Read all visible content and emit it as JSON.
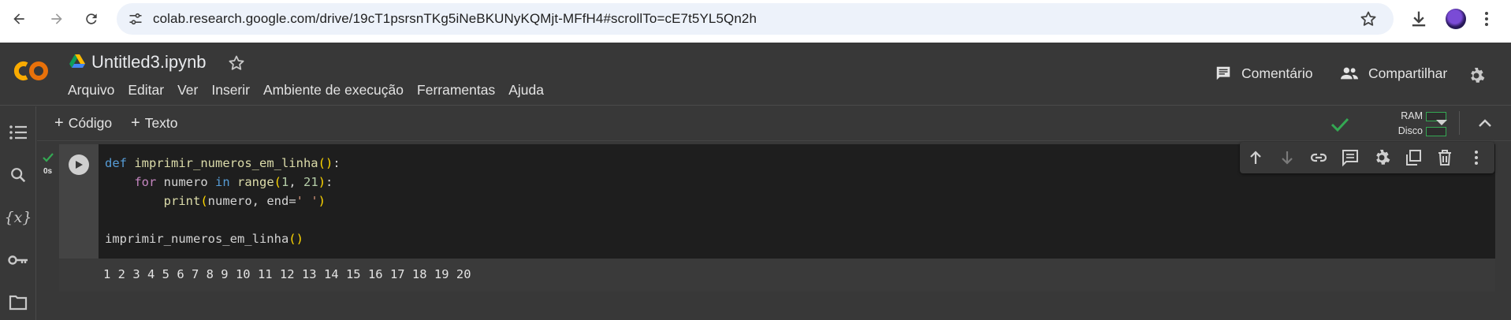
{
  "browser": {
    "url": "colab.research.google.com/drive/19cT1psrsnTKg5iNeBKUNyKQMjt-MFfH4#scrollTo=cE7t5YL5Qn2h",
    "icons": [
      "back-icon",
      "forward-icon",
      "reload-icon",
      "site-info-icon",
      "bookmark-star-icon",
      "downloads-icon",
      "profile-avatar",
      "browser-menu-icon"
    ]
  },
  "header": {
    "notebook_title": "Untitled3.ipynb",
    "menu": [
      "Arquivo",
      "Editar",
      "Ver",
      "Inserir",
      "Ambiente de execução",
      "Ferramentas",
      "Ajuda"
    ],
    "comment_label": "Comentário",
    "share_label": "Compartilhar"
  },
  "toolbar": {
    "add_code_label": "Código",
    "add_text_label": "Texto",
    "ram_label": "RAM",
    "disk_label": "Disco"
  },
  "cell": {
    "exec_time": "0s",
    "status": "executed-ok",
    "code_lines": [
      "def imprimir_numeros_em_linha():",
      "    for numero in range(1, 21):",
      "        print(numero, end=' ')",
      "",
      "imprimir_numeros_em_linha()"
    ],
    "output": "1 2 3 4 5 6 7 8 9 10 11 12 13 14 15 16 17 18 19 20"
  },
  "colors": {
    "accent_orange": "#f9ab00",
    "success_green": "#34a853",
    "background": "#383838",
    "editor_bg": "#1e1e1e"
  }
}
